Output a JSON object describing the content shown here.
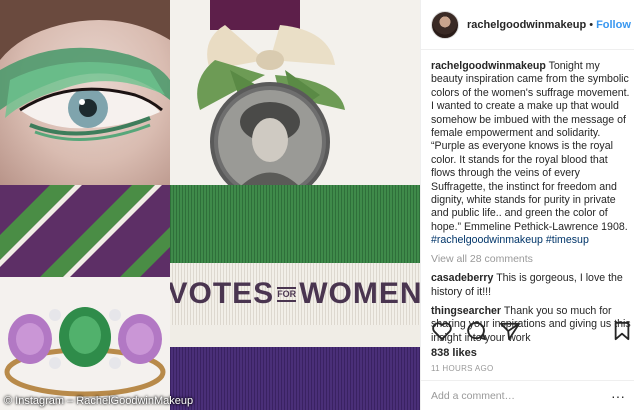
{
  "photo": {
    "credit": "© Instagram – RachelGoodwinMakeup",
    "ribbon_text_left": "VOTES",
    "ribbon_text_small": "FOR",
    "ribbon_text_right": "WOMEN"
  },
  "post": {
    "username": "rachelgoodwinmakeup",
    "separator": "•",
    "follow_label": "Follow",
    "caption_user": "rachelgoodwinmakeup",
    "caption_text": "Tonight my beauty inspiration came from the symbolic colors of the women's suffrage movement. I wanted to create a make up that would somehow be imbued with the message of female empowerment and solidarity. “Purple as everyone knows is the royal color. It stands for the royal blood that flows through the veins of every Suffragette, the instinct for freedom and dignity, white stands for purity in private and public life.. and green the color of hope.” Emmeline Pethick-Lawrence 1908.",
    "hashtag_1": "#rachelgoodwinmakeup",
    "hashtag_2": "#timesup",
    "view_all": "View all 28 comments",
    "comments": [
      {
        "user": "casadeberry",
        "text": "This is gorgeous, I love the history of it!!!"
      },
      {
        "user": "thingsearcher",
        "text": "Thank you so much for sharing your inspirations and giving us this insight into your work"
      }
    ],
    "likes": "838 likes",
    "timestamp": "11 HOURS AGO",
    "add_comment_placeholder": "Add a comment…",
    "more_glyph": "···"
  },
  "icons": [
    "heart-icon",
    "comment-icon",
    "share-icon",
    "bookmark-icon"
  ],
  "colors": {
    "follow": "#3897f0",
    "hashtag": "#003569",
    "muted": "#999999",
    "suffrage_purple": "#5b2c6f",
    "suffrage_green": "#3f8a4a"
  }
}
